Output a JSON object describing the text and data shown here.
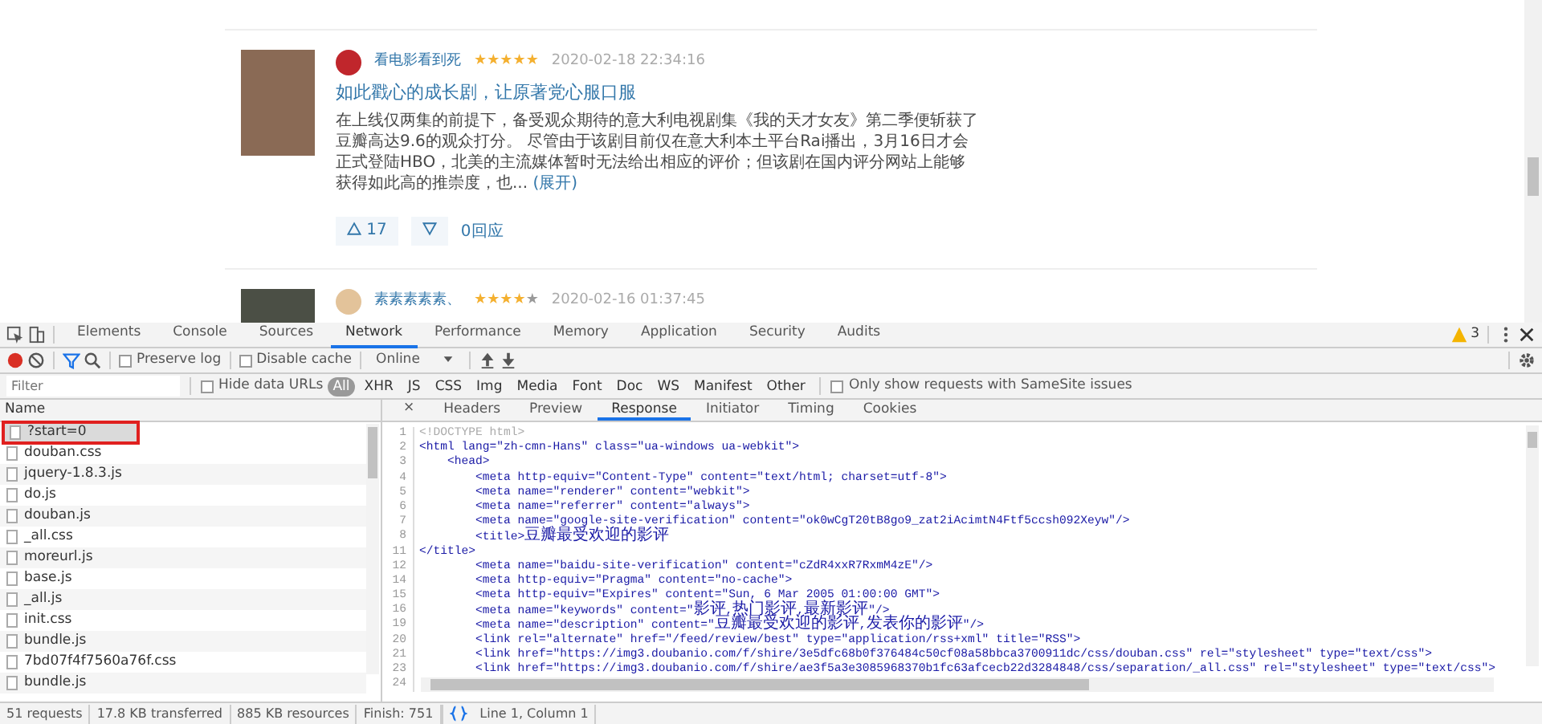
{
  "reviews": [
    {
      "author": "看电影看到死",
      "stars": 5,
      "date": "2020-02-18 22:34:16",
      "title": "如此戳心的成长剧，让原著党心服口服",
      "body": "在上线仅两集的前提下，备受观众期待的意大利电视剧集《我的天才女友》第二季便斩获了豆瓣高达9.6的观众打分。 尽管由于该剧目前仅在意大利本土平台Rai播出，3月16日才会正式登陆HBO，北美的主流媒体暂时无法给出相应的评价；但该剧在国内评分网站上能够获得如此高的推崇度，也...",
      "expand": "(展开)",
      "up": "17",
      "replies": "0回应"
    },
    {
      "author": "素素素素素、",
      "stars": 4,
      "date": "2020-02-16 01:37:45"
    }
  ],
  "devtools": {
    "tabs": [
      {
        "label": "Elements",
        "selected": false
      },
      {
        "label": "Console",
        "selected": false
      },
      {
        "label": "Sources",
        "selected": false
      },
      {
        "label": "Network",
        "selected": true
      },
      {
        "label": "Performance",
        "selected": false
      },
      {
        "label": "Memory",
        "selected": false
      },
      {
        "label": "Application",
        "selected": false
      },
      {
        "label": "Security",
        "selected": false
      },
      {
        "label": "Audits",
        "selected": false
      }
    ],
    "warnings": "3",
    "toolbar": {
      "recording": true,
      "filter_on": true,
      "preserve_log": {
        "label": "Preserve log",
        "checked": false
      },
      "disable_cache": {
        "label": "Disable cache",
        "checked": false
      },
      "throttling": "Online"
    },
    "filter": {
      "placeholder": "Filter",
      "hide_data_urls": {
        "label": "Hide data URLs",
        "checked": false
      },
      "types": [
        {
          "label": "All",
          "selected": true
        },
        {
          "label": "XHR",
          "selected": false
        },
        {
          "label": "JS",
          "selected": false
        },
        {
          "label": "CSS",
          "selected": false
        },
        {
          "label": "Img",
          "selected": false
        },
        {
          "label": "Media",
          "selected": false
        },
        {
          "label": "Font",
          "selected": false
        },
        {
          "label": "Doc",
          "selected": false
        },
        {
          "label": "WS",
          "selected": false
        },
        {
          "label": "Manifest",
          "selected": false
        },
        {
          "label": "Other",
          "selected": false
        }
      ],
      "samesite": {
        "label": "Only show requests with SameSite issues",
        "checked": false
      }
    },
    "name_header": "Name",
    "requests": [
      {
        "name": "?start=0",
        "selected": true,
        "marked": true
      },
      {
        "name": "douban.css",
        "selected": false,
        "marked": false
      },
      {
        "name": "jquery-1.8.3.js",
        "selected": false,
        "marked": false
      },
      {
        "name": "do.js",
        "selected": false,
        "marked": false
      },
      {
        "name": "douban.js",
        "selected": false,
        "marked": false
      },
      {
        "name": "_all.css",
        "selected": false,
        "marked": false
      },
      {
        "name": "moreurl.js",
        "selected": false,
        "marked": false
      },
      {
        "name": "base.js",
        "selected": false,
        "marked": false
      },
      {
        "name": "_all.js",
        "selected": false,
        "marked": false
      },
      {
        "name": "init.css",
        "selected": false,
        "marked": false
      },
      {
        "name": "bundle.js",
        "selected": false,
        "marked": false
      },
      {
        "name": "7bd07f4f7560a76f.css",
        "selected": false,
        "marked": false
      },
      {
        "name": "bundle.js",
        "selected": false,
        "marked": false
      }
    ],
    "detail_close": "×",
    "detail_tabs": [
      {
        "label": "Headers",
        "selected": false
      },
      {
        "label": "Preview",
        "selected": false
      },
      {
        "label": "Response",
        "selected": true
      },
      {
        "label": "Initiator",
        "selected": false
      },
      {
        "label": "Timing",
        "selected": false
      },
      {
        "label": "Cookies",
        "selected": false
      }
    ],
    "code": [
      {
        "n": "1",
        "kind": "comment",
        "text": "<!DOCTYPE html>"
      },
      {
        "n": "2",
        "kind": "code",
        "text": "<html lang=\"zh-cmn-Hans\" class=\"ua-windows ua-webkit\">"
      },
      {
        "n": "3",
        "kind": "code",
        "text": "    <head>"
      },
      {
        "n": "4",
        "kind": "code",
        "text": "        <meta http-equiv=\"Content-Type\" content=\"text/html; charset=utf-8\">"
      },
      {
        "n": "5",
        "kind": "code",
        "text": "        <meta name=\"renderer\" content=\"webkit\">"
      },
      {
        "n": "6",
        "kind": "code",
        "text": "        <meta name=\"referrer\" content=\"always\">"
      },
      {
        "n": "7",
        "kind": "code",
        "text": "        <meta name=\"google-site-verification\" content=\"ok0wCgT20tB8go9_zat2iAcimtN4Ftf5ccsh092Xeyw\"/>"
      },
      {
        "n": "8",
        "kind": "code",
        "text": "        <title>豆瓣最受欢迎的影评"
      },
      {
        "n": "11",
        "kind": "code",
        "text": "</title>"
      },
      {
        "n": "12",
        "kind": "code",
        "text": "        <meta name=\"baidu-site-verification\" content=\"cZdR4xxR7RxmM4zE\"/>"
      },
      {
        "n": "14",
        "kind": "code",
        "text": "        <meta http-equiv=\"Pragma\" content=\"no-cache\">"
      },
      {
        "n": "15",
        "kind": "code",
        "text": "        <meta http-equiv=\"Expires\" content=\"Sun, 6 Mar 2005 01:00:00 GMT\">"
      },
      {
        "n": "16",
        "kind": "code",
        "text": "        <meta name=\"keywords\" content=\"影评,热门影评,最新影评\"/>"
      },
      {
        "n": "19",
        "kind": "code",
        "text": "        <meta name=\"description\" content=\"豆瓣最受欢迎的影评,发表你的影评\"/>"
      },
      {
        "n": "20",
        "kind": "code",
        "text": "        <link rel=\"alternate\" href=\"/feed/review/best\" type=\"application/rss+xml\" title=\"RSS\">"
      },
      {
        "n": "21",
        "kind": "code",
        "text": "        <link href=\"https://img3.doubanio.com/f/shire/3e5dfc68b0f376484c50cf08a58bbca3700911dc/css/douban.css\" rel=\"stylesheet\" type=\"text/css\">"
      },
      {
        "n": "23",
        "kind": "code",
        "text": "        <link href=\"https://img3.doubanio.com/f/shire/ae3f5a3e3085968370b1fc63afcecb22d3284848/css/separation/_all.css\" rel=\"stylesheet\" type=\"text/css\">"
      },
      {
        "n": "24",
        "kind": "scrollbar"
      }
    ],
    "status": [
      "51 requests",
      "17.8 KB transferred",
      "885 KB resources",
      "Finish: 751"
    ],
    "cursor": "Line 1, Column 1"
  }
}
